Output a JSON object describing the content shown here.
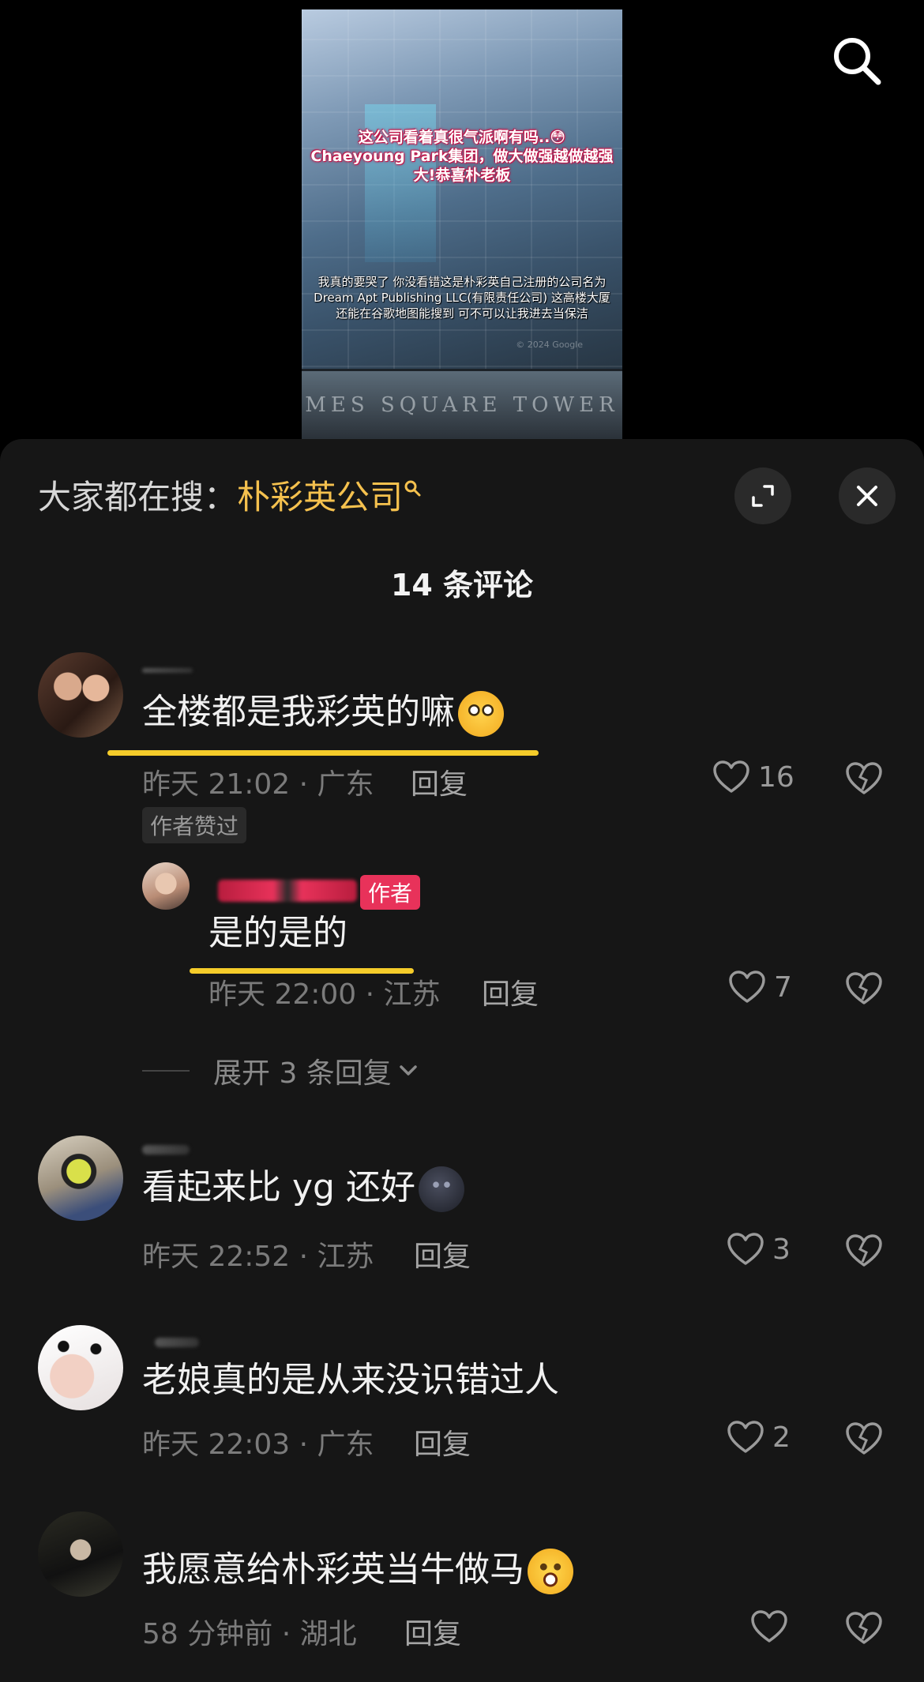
{
  "video": {
    "caption_top": "这公司看着真很气派啊有吗..😳 Chaeyoung Park集团，做大做强越做越强大!恭喜朴老板",
    "caption_bottom": "我真的要哭了 你没看错这是朴彩英自己注册的公司名为Dream Apt Publishing LLC(有限责任公司) 这高楼大厦还能在谷歌地图能搜到 可不可以让我进去当保洁",
    "watermark": "© 2024 Google",
    "building_sign": "MES SQUARE TOWER"
  },
  "header": {
    "search_prefix": "大家都在搜：",
    "search_keyword": "朴彩英公司",
    "comment_count": "14 条评论"
  },
  "comments": [
    {
      "text": "全楼都是我彩英的嘛",
      "time_location": "昨天 21:02 · 广东",
      "reply_label": "回复",
      "likes": "16",
      "tag": "作者赞过",
      "sub_reply": {
        "badge": "作者",
        "text": "是的是的",
        "time_location": "昨天 22:00 · 江苏",
        "reply_label": "回复",
        "likes": "7"
      },
      "expand_label": "展开 3 条回复"
    },
    {
      "text": "看起来比 yg 还好",
      "time_location": "昨天 22:52 · 江苏",
      "reply_label": "回复",
      "likes": "3"
    },
    {
      "text": "老娘真的是从来没识错过人",
      "time_location": "昨天 22:03 · 广东",
      "reply_label": "回复",
      "likes": "2"
    },
    {
      "text": "我愿意给朴彩英当牛做马",
      "time_location": "58 分钟前 · 湖北",
      "reply_label": "回复",
      "likes": ""
    }
  ],
  "colors": {
    "panel_bg": "#161616",
    "keyword": "#f5c14e",
    "underline": "#f5cc2a",
    "author_badge": "#e8325a"
  }
}
